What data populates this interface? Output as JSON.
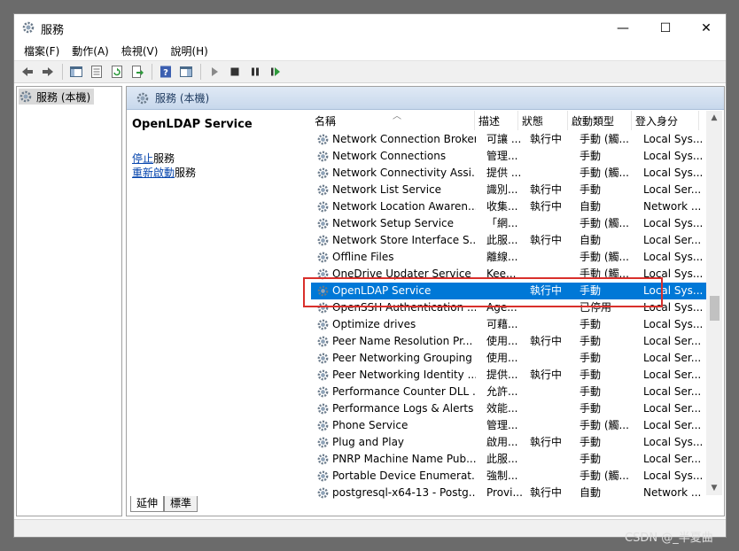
{
  "window": {
    "title": "服務",
    "controls": {
      "minimize": "—",
      "maximize": "☐",
      "close": "✕"
    }
  },
  "menu": [
    "檔案(F)",
    "動作(A)",
    "檢視(V)",
    "說明(H)"
  ],
  "toolbar_icons": [
    "back-icon",
    "forward-icon",
    "show-console-tree-icon",
    "properties-icon",
    "refresh-icon",
    "export-list-icon",
    "help-icon",
    "show-hide-action-pane-icon",
    "start-service-icon",
    "stop-service-icon",
    "pause-service-icon",
    "restart-service-icon"
  ],
  "tree": {
    "item": "服務 (本機)"
  },
  "pane_header": "服務 (本機)",
  "details": {
    "service_title": "OpenLDAP Service",
    "stop_link": "停止",
    "stop_suffix": "服務",
    "restart_link": "重新啟動",
    "restart_suffix": "服務"
  },
  "columns": {
    "name": "名稱",
    "desc": "描述",
    "status": "狀態",
    "startup": "啟動類型",
    "logon": "登入身分"
  },
  "services": [
    {
      "name": "Network Connection Broker",
      "desc": "可讓 ...",
      "status": "執行中",
      "startup": "手動 (觸...",
      "logon": "Local Sys..."
    },
    {
      "name": "Network Connections",
      "desc": "管理...",
      "status": "",
      "startup": "手動",
      "logon": "Local Sys..."
    },
    {
      "name": "Network Connectivity Assi...",
      "desc": "提供 ...",
      "status": "",
      "startup": "手動 (觸...",
      "logon": "Local Sys..."
    },
    {
      "name": "Network List Service",
      "desc": "識別...",
      "status": "執行中",
      "startup": "手動",
      "logon": "Local Ser..."
    },
    {
      "name": "Network Location Awaren...",
      "desc": "收集...",
      "status": "執行中",
      "startup": "自動",
      "logon": "Network ..."
    },
    {
      "name": "Network Setup Service",
      "desc": "「網...",
      "status": "",
      "startup": "手動 (觸...",
      "logon": "Local Sys..."
    },
    {
      "name": "Network Store Interface S...",
      "desc": "此服...",
      "status": "執行中",
      "startup": "自動",
      "logon": "Local Ser..."
    },
    {
      "name": "Offline Files",
      "desc": "離線...",
      "status": "",
      "startup": "手動 (觸...",
      "logon": "Local Sys..."
    },
    {
      "name": "OneDrive Updater Service",
      "desc": "Kee...",
      "status": "",
      "startup": "手動 (觸...",
      "logon": "Local Sys..."
    },
    {
      "name": "OpenLDAP Service",
      "desc": "",
      "status": "執行中",
      "startup": "手動",
      "logon": "Local Sys...",
      "selected": true
    },
    {
      "name": "OpenSSH Authentication ...",
      "desc": "Age...",
      "status": "",
      "startup": "已停用",
      "logon": "Local Sys..."
    },
    {
      "name": "Optimize drives",
      "desc": "可藉...",
      "status": "",
      "startup": "手動",
      "logon": "Local Sys..."
    },
    {
      "name": "Peer Name Resolution Pr...",
      "desc": "使用...",
      "status": "執行中",
      "startup": "手動",
      "logon": "Local Ser..."
    },
    {
      "name": "Peer Networking Grouping",
      "desc": "使用...",
      "status": "",
      "startup": "手動",
      "logon": "Local Ser..."
    },
    {
      "name": "Peer Networking Identity ...",
      "desc": "提供...",
      "status": "執行中",
      "startup": "手動",
      "logon": "Local Ser..."
    },
    {
      "name": "Performance Counter DLL ...",
      "desc": "允許...",
      "status": "",
      "startup": "手動",
      "logon": "Local Ser..."
    },
    {
      "name": "Performance Logs & Alerts",
      "desc": "效能...",
      "status": "",
      "startup": "手動",
      "logon": "Local Ser..."
    },
    {
      "name": "Phone Service",
      "desc": "管理...",
      "status": "",
      "startup": "手動 (觸...",
      "logon": "Local Ser..."
    },
    {
      "name": "Plug and Play",
      "desc": "啟用...",
      "status": "執行中",
      "startup": "手動",
      "logon": "Local Sys..."
    },
    {
      "name": "PNRP Machine Name Pub...",
      "desc": "此服...",
      "status": "",
      "startup": "手動",
      "logon": "Local Ser..."
    },
    {
      "name": "Portable Device Enumerat...",
      "desc": "強制...",
      "status": "",
      "startup": "手動 (觸...",
      "logon": "Local Sys..."
    },
    {
      "name": "postgresql-x64-13 - Postg...",
      "desc": "Provi...",
      "status": "執行中",
      "startup": "自動",
      "logon": "Network ..."
    }
  ],
  "tabs": [
    "延伸",
    "標準"
  ],
  "watermark": "CSDN @_半夏曲",
  "colors": {
    "selection": "#0078d7",
    "highlight": "#d9302c",
    "link": "#0645ad"
  }
}
